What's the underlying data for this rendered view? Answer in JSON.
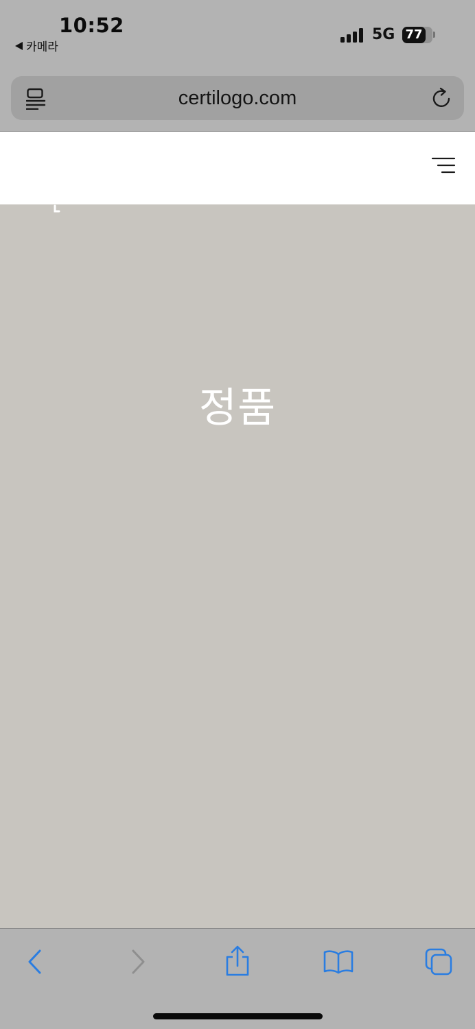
{
  "status_bar": {
    "time": "10:52",
    "back_app_label": "카메라",
    "network": "5G",
    "battery_level": "77",
    "battery_fraction": 0.77
  },
  "browser": {
    "url": "certilogo.com",
    "icons": {
      "reader": "reader-mode-icon",
      "reload": "reload-icon",
      "back": "chevron-left-icon",
      "forward": "chevron-right-icon",
      "share": "share-icon",
      "bookmarks": "book-icon",
      "tabs": "tabs-icon"
    },
    "colors": {
      "chrome": "#b3b3b3",
      "address_field": "#a1a1a1",
      "accent": "#2a7de1",
      "disabled": "#8f8f8f"
    }
  },
  "page": {
    "menu_icon": "menu-icon",
    "hero_title": "정품",
    "colors": {
      "header": "#ffffff",
      "hero_background": "#c8c5bf",
      "hero_text": "#ffffff"
    }
  }
}
